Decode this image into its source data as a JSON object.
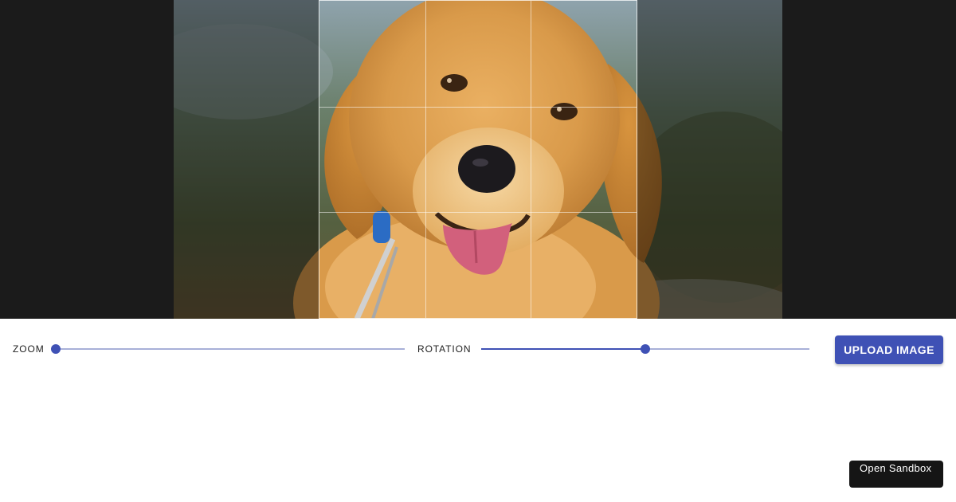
{
  "cropper": {
    "image_subject": "golden retriever puppy",
    "grid": "rule-of-thirds"
  },
  "controls": {
    "zoom": {
      "label": "ZOOM",
      "value_fraction": 0.0
    },
    "rotation": {
      "label": "ROTATION",
      "value_fraction": 0.5
    },
    "upload_label": "UPLOAD IMAGE"
  },
  "sandbox": {
    "label": "Open Sandbox"
  },
  "colors": {
    "accent": "#3f51b5",
    "accent_light": "#a8b0d8",
    "cropper_bg": "#1b1b1b",
    "sandbox_bg": "#151515"
  }
}
